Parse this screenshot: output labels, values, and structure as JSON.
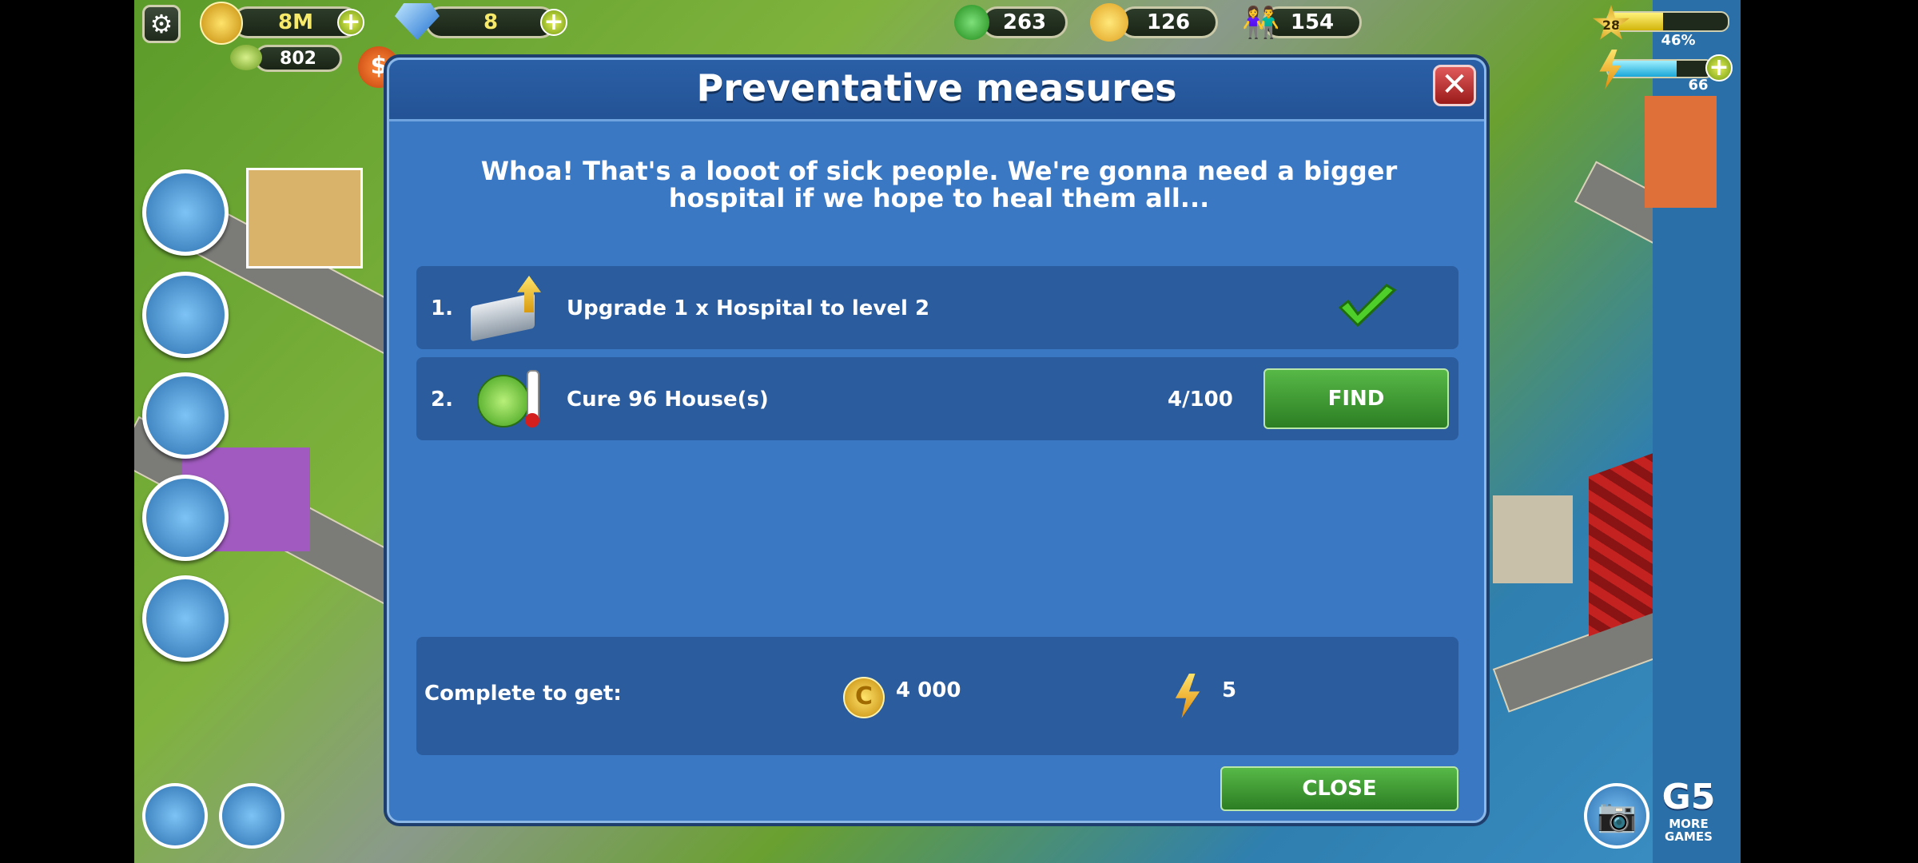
{
  "hud": {
    "coins": "8M",
    "gems": "8",
    "sub_currency": "802",
    "trees": "263",
    "happiness": "126",
    "population": "154",
    "level": "28",
    "xp_percent": "46%",
    "energy": "66",
    "xp_fraction": 0.46,
    "energy_fraction": 0.66
  },
  "dialog": {
    "title": "Preventative measures",
    "intro": "Whoa! That's a looot of sick people. We're gonna need a bigger hospital if we hope to heal them all...",
    "tasks": [
      {
        "number": "1.",
        "text": "Upgrade 1 x Hospital to level 2",
        "status": "done"
      },
      {
        "number": "2.",
        "text": "Cure 96 House(s)",
        "progress": "4/100",
        "button": "FIND"
      }
    ],
    "reward_label": "Complete to get:",
    "reward_coins": "4 000",
    "reward_energy": "5",
    "close_label": "CLOSE"
  },
  "branding": {
    "logo": "G5",
    "more_games": "MORE GAMES"
  },
  "colors": {
    "dialog_bg": "#3a78c4",
    "panel_bg": "#2b5c9e",
    "button_green": "#3f9a32",
    "close_red": "#c23a3a"
  }
}
